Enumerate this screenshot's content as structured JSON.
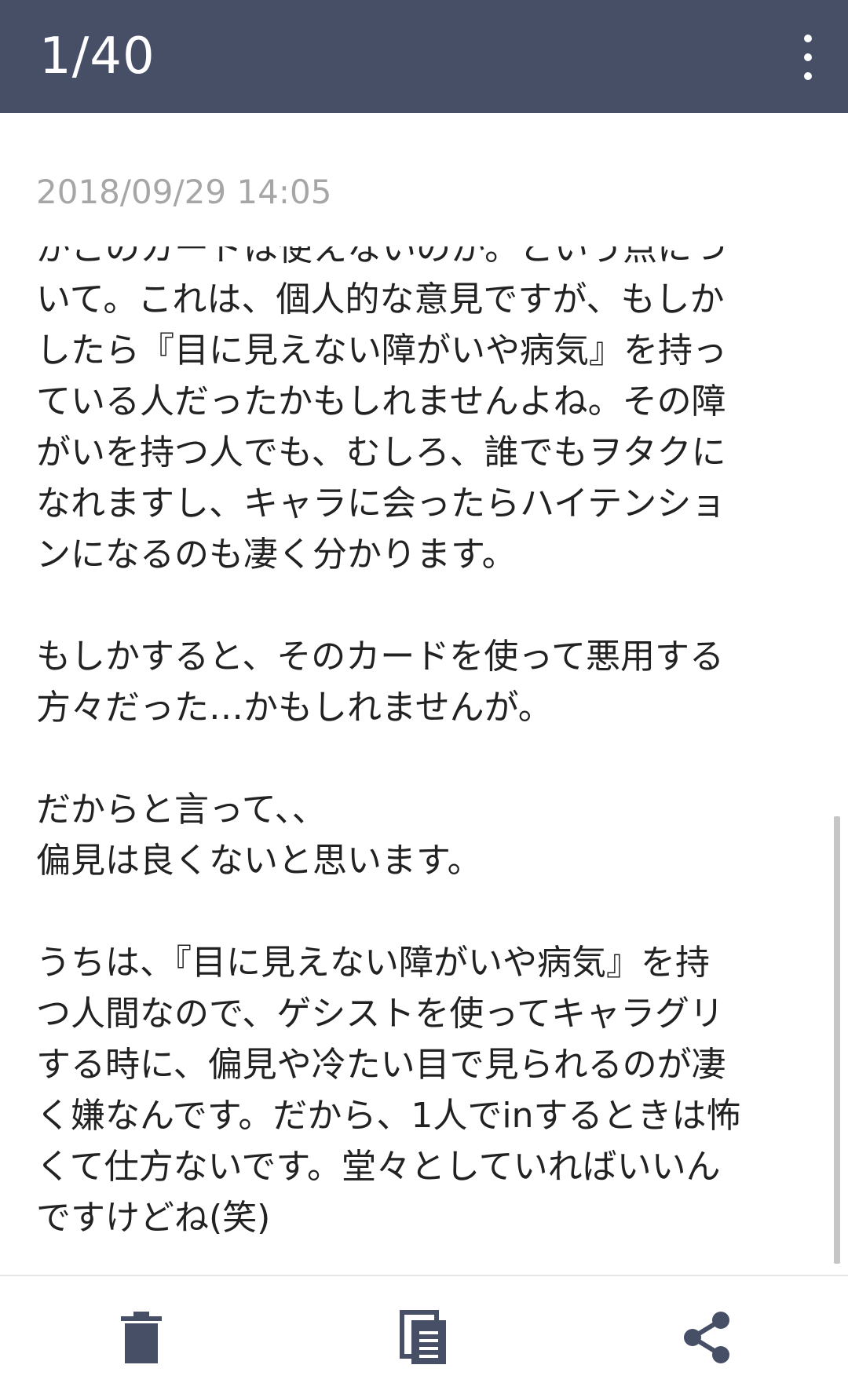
{
  "appbar": {
    "title": "1/40",
    "menu_icon": "more-vert-icon"
  },
  "note": {
    "timestamp": "2018/09/29 14:05",
    "lines": [
      "がこのカードは使えないのか。という点につ",
      "いて。これは、個人的な意見ですが、もしか",
      "したら『目に見えない障がいや病気』を持っ",
      "ている人だったかもしれませんよね。その障",
      "がいを持つ人でも、むしろ、誰でもヲタクに",
      "なれますし、キャラに会ったらハイテンショ",
      "ンになるのも凄く分かります。",
      "",
      "もしかすると、そのカードを使って悪用する",
      "方々だった…かもしれませんが。",
      "",
      "だからと言って、、",
      "偏見は良くないと思います。",
      "",
      "うちは、『目に見えない障がいや病気』を持",
      "つ人間なので、ゲシストを使ってキャラグリ",
      "する時に、偏見や冷たい目で見られるのが凄",
      "く嫌なんです。だから、1人でinするときは怖",
      "くて仕方ないです。堂々としていればいいん",
      "ですけどね(笑)"
    ]
  },
  "toolbar": {
    "delete_icon": "trash-icon",
    "copy_icon": "copy-icon",
    "share_icon": "share-icon"
  },
  "colors": {
    "appbar_bg": "#474f67",
    "icon": "#474f67",
    "timestamp": "#a6a6a6",
    "text": "#222222"
  }
}
